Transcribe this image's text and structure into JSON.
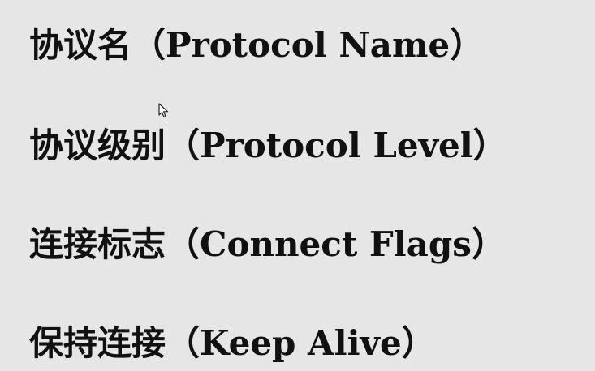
{
  "lines": [
    {
      "zh": "协议名",
      "open": "（",
      "en": "Protocol Name",
      "close": "）"
    },
    {
      "zh": "协议级别",
      "open": "（",
      "en": "Protocol Level",
      "close": "）"
    },
    {
      "zh": "连接标志",
      "open": "（",
      "en": "Connect Flags",
      "close": "）"
    },
    {
      "zh": "保持连接",
      "open": "（",
      "en": "Keep Alive",
      "close": "）"
    }
  ],
  "colors": {
    "background": "#e6e6e6",
    "text": "#111111"
  },
  "icons": {
    "cursor": "mouse-pointer-icon"
  }
}
